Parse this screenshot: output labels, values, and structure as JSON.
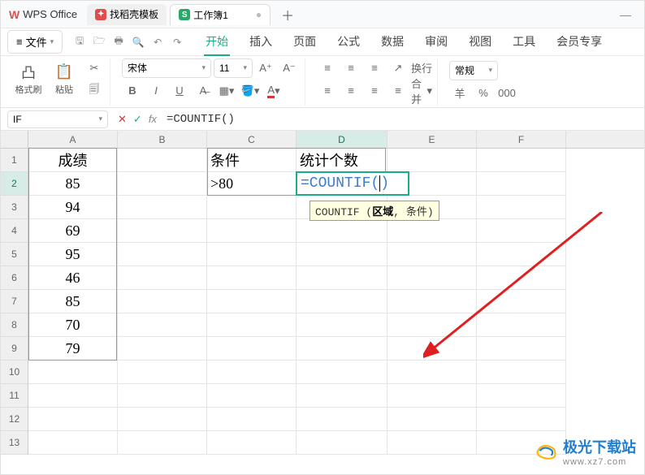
{
  "titlebar": {
    "app_name": "WPS Office",
    "tabs": [
      {
        "label": "找稻壳模板",
        "icon_bg": "#e04b4b",
        "icon_txt": ""
      },
      {
        "label": "工作簿1",
        "icon_bg": "#2ba76a",
        "icon_txt": "S"
      }
    ],
    "add": "＋"
  },
  "menubar": {
    "file_label": "文件",
    "hamburger": "≡",
    "items": [
      "开始",
      "插入",
      "页面",
      "公式",
      "数据",
      "审阅",
      "视图",
      "工具",
      "会员专享"
    ],
    "active_index": 0
  },
  "toolbar": {
    "format_painter": "格式刷",
    "paste": "粘贴",
    "font_name": "宋体",
    "font_size": "11",
    "wrap": "换行",
    "merge": "合并",
    "number_format": "常规",
    "currency": "羊",
    "percent": "%",
    "thousands": "000"
  },
  "formula_bar": {
    "name_box": "IF",
    "cancel": "✕",
    "confirm": "✓",
    "fx": "fx",
    "formula": "=COUNTIF()"
  },
  "grid": {
    "columns": [
      "A",
      "B",
      "C",
      "D",
      "E",
      "F"
    ],
    "active_col_index": 3,
    "active_row_index": 1,
    "rows": [
      {
        "n": "1",
        "cells": [
          "成绩",
          "",
          "条件",
          "统计个数",
          "",
          ""
        ]
      },
      {
        "n": "2",
        "cells": [
          "85",
          "",
          ">80",
          "",
          "",
          ""
        ]
      },
      {
        "n": "3",
        "cells": [
          "94",
          "",
          "",
          "",
          "",
          ""
        ]
      },
      {
        "n": "4",
        "cells": [
          "69",
          "",
          "",
          "",
          "",
          ""
        ]
      },
      {
        "n": "5",
        "cells": [
          "95",
          "",
          "",
          "",
          "",
          ""
        ]
      },
      {
        "n": "6",
        "cells": [
          "46",
          "",
          "",
          "",
          "",
          ""
        ]
      },
      {
        "n": "7",
        "cells": [
          "85",
          "",
          "",
          "",
          "",
          ""
        ]
      },
      {
        "n": "8",
        "cells": [
          "70",
          "",
          "",
          "",
          "",
          ""
        ]
      },
      {
        "n": "9",
        "cells": [
          "79",
          "",
          "",
          "",
          "",
          ""
        ]
      },
      {
        "n": "10",
        "cells": [
          "",
          "",
          "",
          "",
          "",
          ""
        ]
      },
      {
        "n": "11",
        "cells": [
          "",
          "",
          "",
          "",
          "",
          ""
        ]
      },
      {
        "n": "12",
        "cells": [
          "",
          "",
          "",
          "",
          "",
          ""
        ]
      },
      {
        "n": "13",
        "cells": [
          "",
          "",
          "",
          "",
          "",
          ""
        ]
      }
    ],
    "editing_cell": {
      "text_before": "=COUNTIF(",
      "text_after": ")"
    },
    "tooltip": {
      "func": "COUNTIF (",
      "arg1": "区域",
      "rest": ", 条件)"
    }
  },
  "watermark": {
    "name": "极光下载站",
    "url": "www.xz7.com"
  }
}
